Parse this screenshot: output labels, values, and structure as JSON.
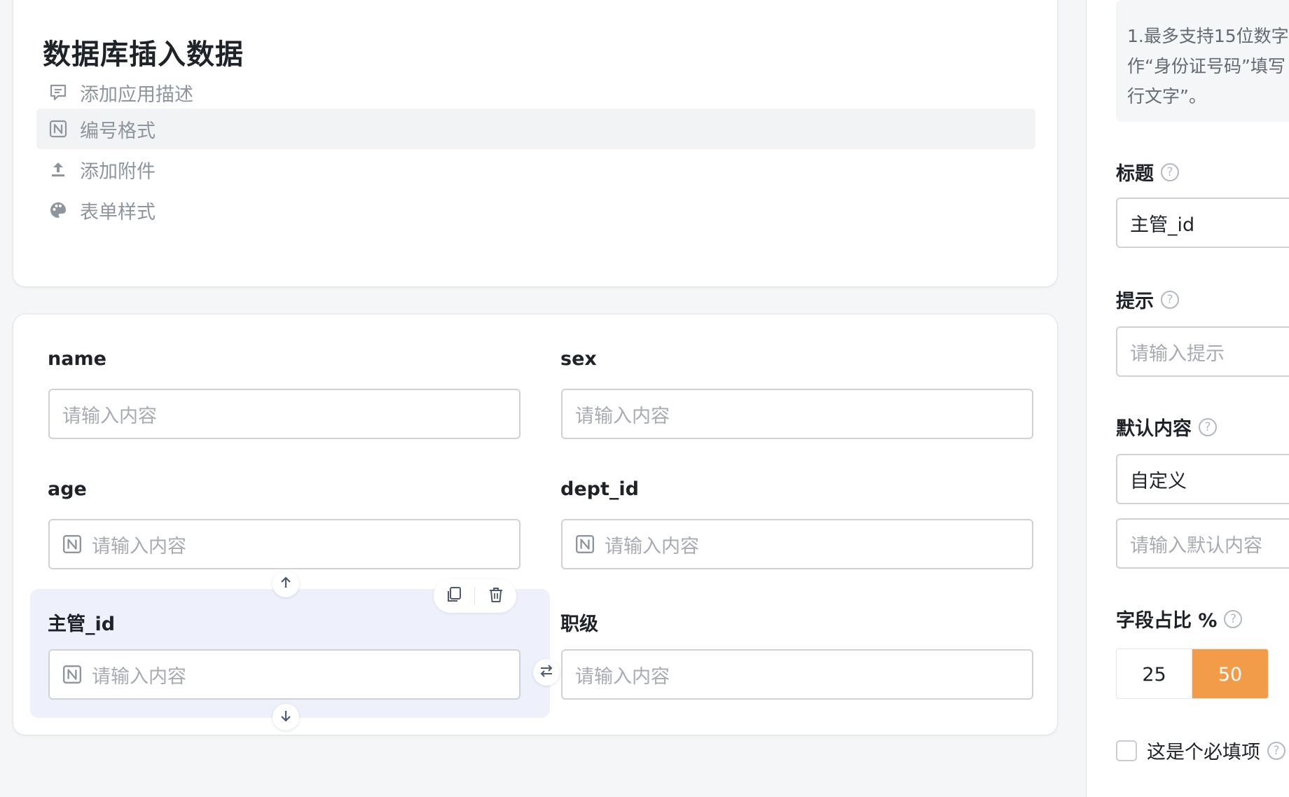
{
  "app": {
    "title": "数据库插入数据",
    "menu": [
      {
        "icon": "comment-icon",
        "label": "添加应用描述",
        "active": false
      },
      {
        "icon": "number-format-icon",
        "label": "编号格式",
        "active": true
      },
      {
        "icon": "upload-icon",
        "label": "添加附件",
        "active": false
      },
      {
        "icon": "palette-icon",
        "label": "表单样式",
        "active": false
      }
    ]
  },
  "form": {
    "fields": [
      {
        "label": "name",
        "placeholder": "请输入内容",
        "numeric": false
      },
      {
        "label": "sex",
        "placeholder": "请输入内容",
        "numeric": false
      },
      {
        "label": "age",
        "placeholder": "请输入内容",
        "numeric": true
      },
      {
        "label": "dept_id",
        "placeholder": "请输入内容",
        "numeric": true
      },
      {
        "label": "主管_id",
        "placeholder": "请输入内容",
        "numeric": true,
        "selected": true
      },
      {
        "label": "职级",
        "placeholder": "请输入内容",
        "numeric": false
      }
    ]
  },
  "panel": {
    "help_text": "1.最多支持15位数字\n作“身份证号码”填写\n行文字”。",
    "title_label": "标题",
    "title_value": "主管_id",
    "hint_label": "提示",
    "hint_placeholder": "请输入提示",
    "default_label": "默认内容",
    "default_select": "自定义",
    "default_placeholder": "请输入默认内容",
    "ratio_label": "字段占比 %",
    "ratio_options": [
      "25",
      "50"
    ],
    "ratio_selected": "50",
    "required_label": "这是个必填项"
  },
  "colors": {
    "accent": "#f29c4a",
    "selected_bg": "#eef0fc"
  }
}
